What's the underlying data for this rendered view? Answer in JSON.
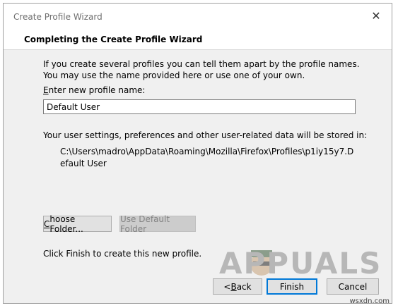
{
  "window": {
    "title": "Create Profile Wizard",
    "close_glyph": "✕"
  },
  "header": {
    "title": "Completing the Create Profile Wizard"
  },
  "body": {
    "intro_text": "If you create several profiles you can tell them apart by the profile names. You may use the name provided here or use one of your own.",
    "name_label_accel": "E",
    "name_label_rest": "nter new profile name:",
    "name_value": "Default User",
    "storage_label": "Your user settings, preferences and other user-related data will be stored in:",
    "storage_path": "C:\\Users\\madro\\AppData\\Roaming\\Mozilla\\Firefox\\Profiles\\p1iy15y7.Default User",
    "choose_folder_accel": "C",
    "choose_folder_rest": "hoose Folder...",
    "use_default_folder": "Use Default Folder",
    "finish_message": "Click Finish to create this new profile."
  },
  "footer": {
    "back_prefix": "< ",
    "back_accel": "B",
    "back_rest": "ack",
    "finish": "Finish",
    "cancel": "Cancel"
  },
  "watermark": {
    "text": "APPUALS"
  },
  "site_tag": "wsxdn.com"
}
